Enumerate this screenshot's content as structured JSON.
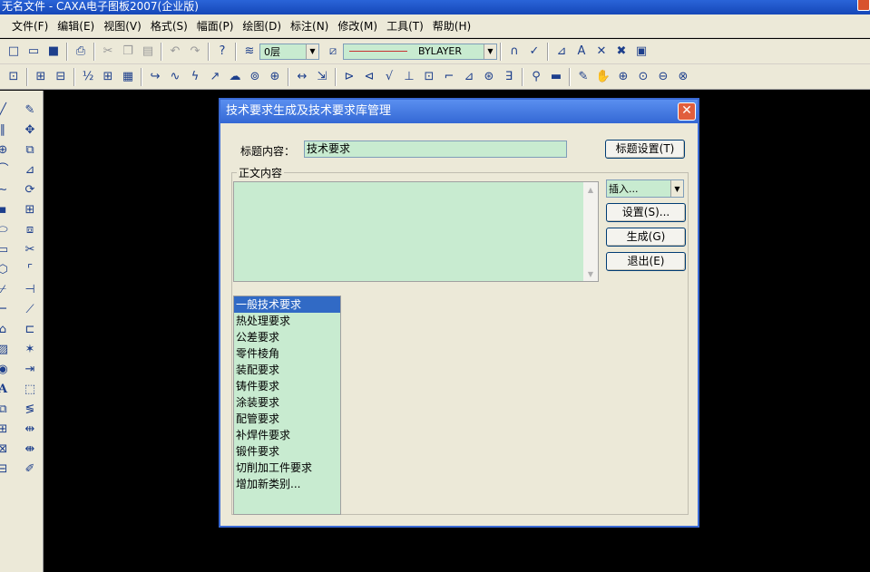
{
  "window": {
    "title": "无名文件 - CAXA电子图板2007(企业版)"
  },
  "menu": [
    "文件(F)",
    "编辑(E)",
    "视图(V)",
    "格式(S)",
    "幅面(P)",
    "绘图(D)",
    "标注(N)",
    "修改(M)",
    "工具(T)",
    "帮助(H)"
  ],
  "toolbar": {
    "layer_value": "0层",
    "linetype_value": "BYLAYER"
  },
  "dialog": {
    "title": "技术要求生成及技术要求库管理",
    "title_label": "标题内容：",
    "title_value": "技术要求",
    "title_settings_button": "标题设置(T)",
    "body_group_label": "正文内容",
    "insert_value": "插入...",
    "settings_button": "设置(S)...",
    "generate_button": "生成(G)",
    "exit_button": "退出(E)",
    "categories": [
      "一般技术要求",
      "热处理要求",
      "公差要求",
      "零件棱角",
      "装配要求",
      "铸件要求",
      "涂装要求",
      "配管要求",
      "补焊件要求",
      "锻件要求",
      "切削加工件要求",
      "增加新类别..."
    ],
    "selected_category": "一般技术要求"
  },
  "colors": {
    "field_bg": "#c8ebd0",
    "dialog_bg": "#ece9d8",
    "canvas_bg": "#000000",
    "title_blue": "#3468d4"
  }
}
